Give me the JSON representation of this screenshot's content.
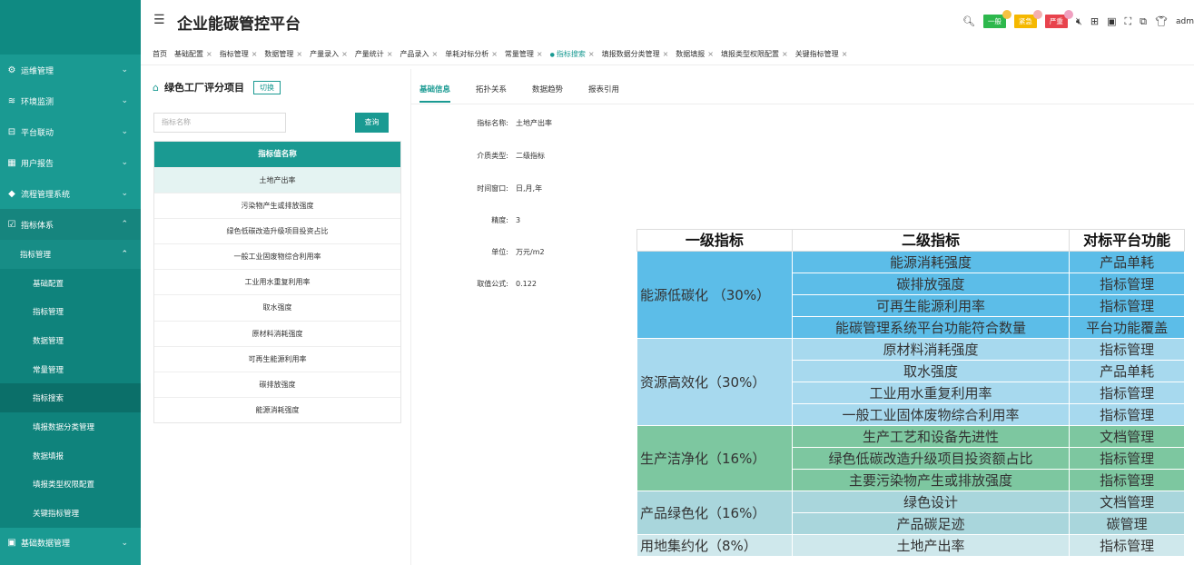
{
  "sidebar": {
    "items": [
      {
        "label": "运维管理",
        "icon": "gear-circle-icon",
        "chev": "⌄"
      },
      {
        "label": "环境监测",
        "icon": "wave-icon",
        "chev": "⌄"
      },
      {
        "label": "平台联动",
        "icon": "link-icon",
        "chev": "⌄"
      },
      {
        "label": "用户报告",
        "icon": "report-icon",
        "chev": "⌄"
      },
      {
        "label": "流程管理系统",
        "icon": "flow-icon",
        "chev": "⌄"
      },
      {
        "label": "指标体系",
        "icon": "edit-icon",
        "chev": "⌃"
      }
    ],
    "sub": {
      "label": "指标管理",
      "chev": "⌃"
    },
    "subitems": [
      "基础配置",
      "指标管理",
      "数据管理",
      "常量管理",
      "指标搜索",
      "填报数据分类管理",
      "数据填报",
      "填报类型权限配置",
      "关键指标管理"
    ],
    "bottom": {
      "label": "基础数据管理",
      "chev": "⌄"
    }
  },
  "header": {
    "title": "企业能碳管控平台",
    "badges": [
      {
        "label": "一般",
        "color": "#2db84d",
        "dot": "#f5c242"
      },
      {
        "label": "紧急",
        "color": "#f5b800",
        "dot": "#f0a0a0"
      },
      {
        "label": "严重",
        "color": "#e8434d",
        "dot": "#f0a0c0"
      }
    ],
    "user": "adm"
  },
  "tabs": [
    "首页",
    "基础配置",
    "指标管理",
    "数据管理",
    "产量录入",
    "产量统计",
    "产品录入",
    "单耗对标分析",
    "常量管理",
    "指标搜索",
    "填报数据分类管理",
    "数据填报",
    "填报类型权限配置",
    "关键指标管理"
  ],
  "panel": {
    "title": "绿色工厂评分项目",
    "switch": "切换",
    "search_placeholder": "指标名称",
    "query": "查询",
    "table_header": "指标值名称",
    "rows": [
      "土地产出率",
      "污染物产生或排放强度",
      "绿色低碳改造升级项目投资占比",
      "一般工业固废物综合利用率",
      "工业用水重复利用率",
      "取水强度",
      "原材料消耗强度",
      "可再生能源利用率",
      "碳排放强度",
      "能源消耗强度"
    ]
  },
  "detail": {
    "tabs": [
      "基础信息",
      "拓扑关系",
      "数据趋势",
      "报表引用"
    ],
    "fields": [
      {
        "label": "指标名称:",
        "value": "土地产出率"
      },
      {
        "label": "介质类型:",
        "value": "二级指标"
      },
      {
        "label": "时间窗口:",
        "value": "日,月,年"
      },
      {
        "label": "精度:",
        "value": "3"
      },
      {
        "label": "单位:",
        "value": "万元/m2"
      },
      {
        "label": "取值公式:",
        "value": "0.122"
      }
    ]
  },
  "overlay": {
    "headers": [
      "一级指标",
      "二级指标",
      "对标平台功能"
    ],
    "groups": [
      {
        "name": "能源低碳化 （30%）",
        "cls": "g1",
        "rows": [
          [
            "能源消耗强度",
            "产品单耗"
          ],
          [
            "碳排放强度",
            "指标管理"
          ],
          [
            "可再生能源利用率",
            "指标管理"
          ],
          [
            "能碳管理系统平台功能符合数量",
            "平台功能覆盖"
          ]
        ]
      },
      {
        "name": "资源高效化（30%）",
        "cls": "g2",
        "rows": [
          [
            "原材料消耗强度",
            "指标管理"
          ],
          [
            "取水强度",
            "产品单耗"
          ],
          [
            "工业用水重复利用率",
            "指标管理"
          ],
          [
            "一般工业固体废物综合利用率",
            "指标管理"
          ]
        ]
      },
      {
        "name": "生产洁净化（16%）",
        "cls": "g3",
        "rows": [
          [
            "生产工艺和设备先进性",
            "文档管理"
          ],
          [
            "绿色低碳改造升级项目投资额占比",
            "指标管理"
          ],
          [
            "主要污染物产生或排放强度",
            "指标管理"
          ]
        ]
      },
      {
        "name": "产品绿色化（16%）",
        "cls": "g4",
        "rows": [
          [
            "绿色设计",
            "文档管理"
          ],
          [
            "产品碳足迹",
            "碳管理"
          ]
        ]
      },
      {
        "name": "用地集约化（8%）",
        "cls": "g5",
        "rows": [
          [
            "土地产出率",
            "指标管理"
          ]
        ]
      }
    ]
  }
}
